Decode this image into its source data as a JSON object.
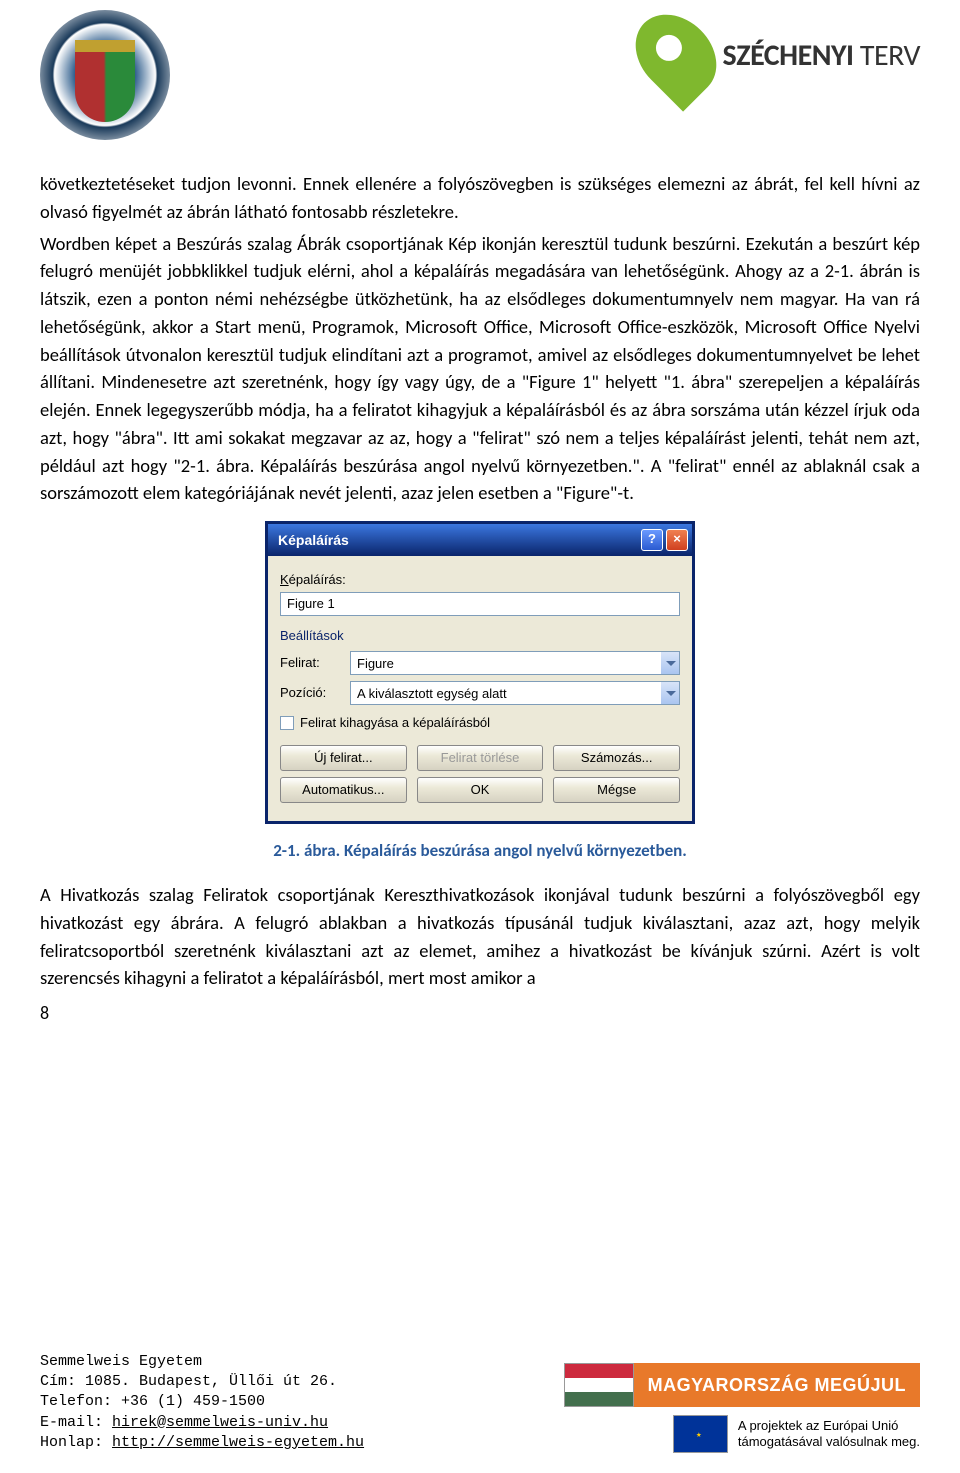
{
  "header": {
    "szechenyi_brand_strong": "SZÉCHENYI",
    "szechenyi_brand_light": " TERV"
  },
  "body": {
    "paragraph1": "következtetéseket tudjon levonni.  Ennek ellenére a folyószövegben is szükséges elemezni az ábrát, fel kell hívni az olvasó figyelmét az ábrán látható fontosabb részletekre.",
    "paragraph2": "Wordben képet a Beszúrás szalag Ábrák csoportjának Kép ikonján keresztül tudunk beszúrni.  Ezekután a beszúrt kép felugró menüjét jobbklikkel tudjuk elérni, ahol a képaláírás megadására van lehetőségünk. Ahogy az a 2-1. ábrán is látszik, ezen a ponton némi nehézségbe ütközhetünk, ha az elsődleges dokumentumnyelv nem magyar.  Ha van rá lehetőségünk, akkor a Start menü, Programok, Microsoft Office, Microsoft Office-eszközök, Microsoft Office Nyelvi beállítások útvonalon keresztül tudjuk elindítani azt a programot, amivel az elsődleges dokumentumnyelvet be lehet állítani.  Mindenesetre azt szeretnénk, hogy így vagy úgy, de a \"Figure 1\" helyett \"1. ábra\" szerepeljen a képaláírás elején.  Ennek legegyszerűbb módja, ha a feliratot kihagyjuk a képaláírásból és az ábra sorszáma után kézzel írjuk oda azt, hogy \"ábra\".  Itt ami sokakat megzavar az az, hogy a \"felirat\" szó nem a teljes képaláírást jelenti, tehát nem azt, például azt hogy \"2-1. ábra.  Képaláírás beszúrása angol nyelvű környezetben.\".  A \"felirat\" ennél az ablaknál csak a sorszámozott elem kategóriájának nevét jelenti, azaz jelen esetben a \"Figure\"-t.",
    "paragraph3": "A Hivatkozás szalag Feliratok csoportjának Kereszthivatkozások ikonjával tudunk beszúrni a folyószövegből egy hivatkozást egy ábrára.  A felugró ablakban a hivatkozás típusánál tudjuk kiválasztani, azaz azt, hogy melyik feliratcsoportból szeretnénk kiválasztani azt az elemet, amihez a hivatkozást be kívánjuk szúrni.  Azért is volt szerencsés kihagyni a feliratot a képaláírásból, mert most amikor a"
  },
  "dialog": {
    "title": "Képaláírás",
    "section_label": "Képaláírás:",
    "caption_value": "Figure 1",
    "settings_label": "Beállítások",
    "felirat_label": "Felirat:",
    "felirat_value": "Figure",
    "pozicio_label": "Pozíció:",
    "pozicio_value": "A kiválasztott egység alatt",
    "checkbox_label": "Felirat kihagyása a képaláírásból",
    "btn_uj_felirat": "Új felirat...",
    "btn_felirat_torlese": "Felirat törlése",
    "btn_szamozas": "Számozás...",
    "btn_automatikus": "Automatikus...",
    "btn_ok": "OK",
    "btn_megse": "Mégse"
  },
  "figure_caption": "2-1. ábra.  Képaláírás beszúrása angol nyelvű környezetben.",
  "page_number": "8",
  "footer": {
    "org": "Semmelweis Egyetem",
    "address": "Cím: 1085. Budapest, Üllői út 26.",
    "phone": "Telefon: +36 (1) 459-1500",
    "email_label": "E-mail: ",
    "email": "hirek@semmelweis-univ.hu",
    "web_label": "Honlap: ",
    "web": "http://semmelweis-egyetem.hu",
    "banner": "MAGYARORSZÁG MEGÚJUL",
    "eu_line1": "A projektek az Európai Unió",
    "eu_line2": "támogatásával valósulnak meg."
  }
}
